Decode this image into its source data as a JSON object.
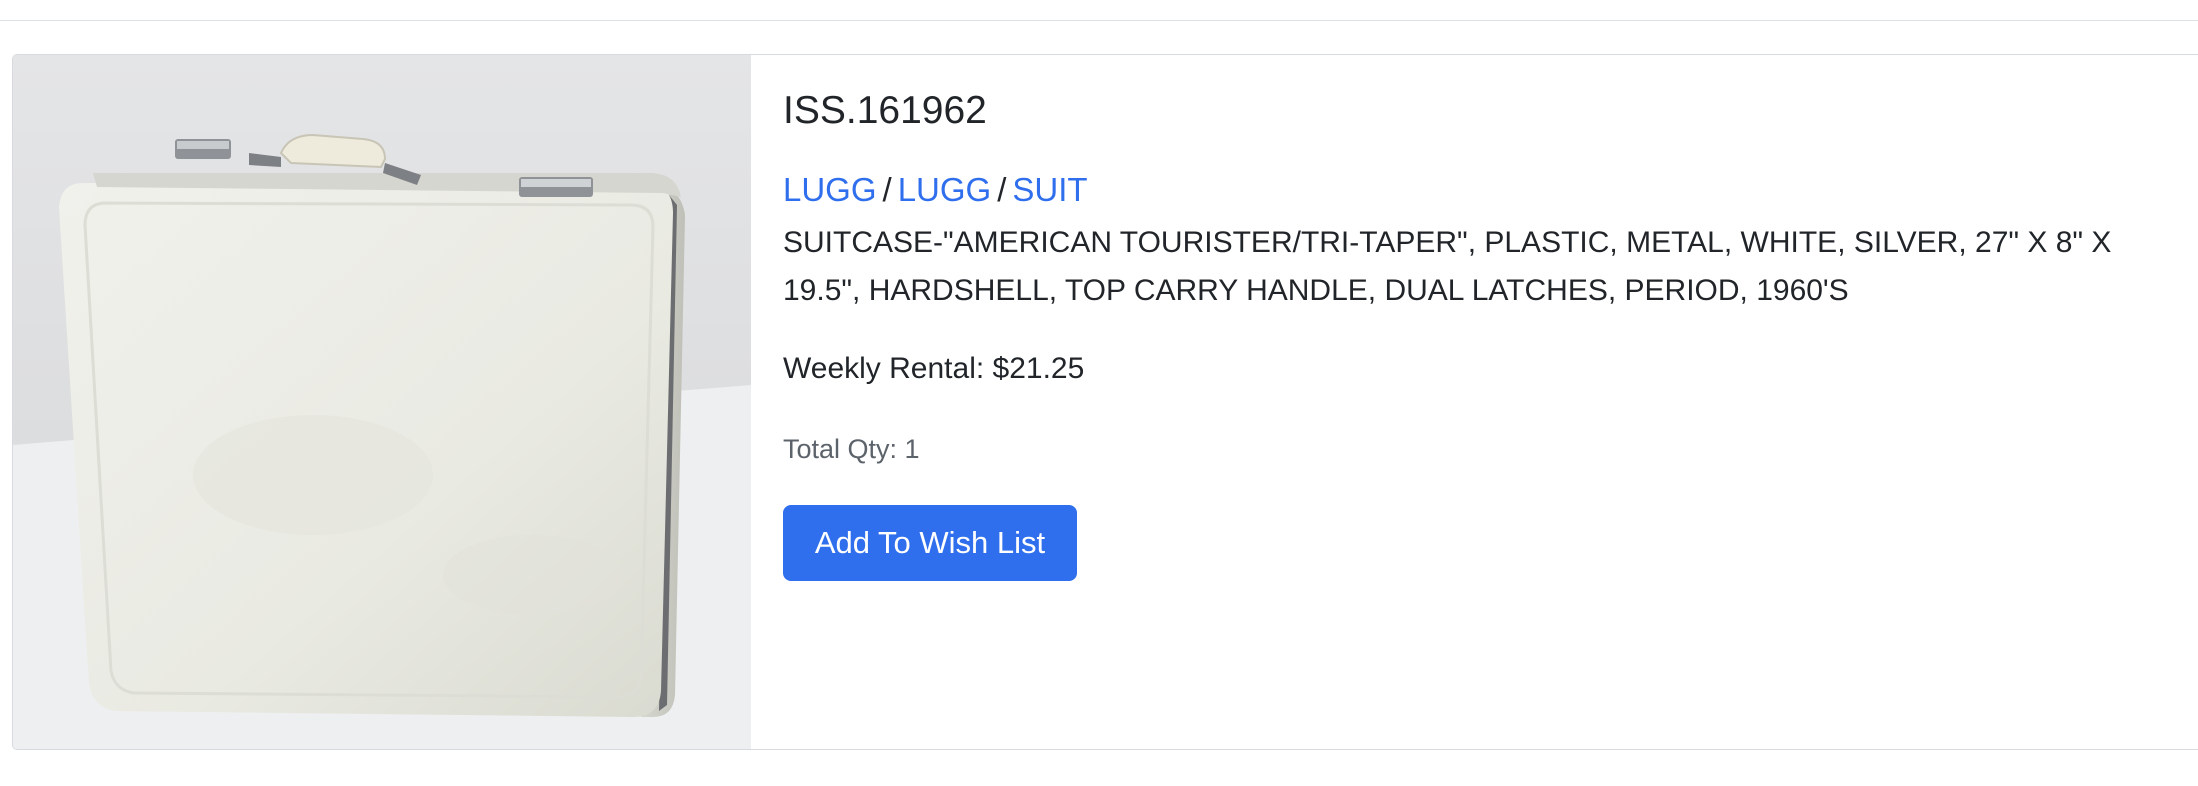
{
  "item": {
    "id": "ISS.161962",
    "breadcrumb": [
      "LUGG",
      "LUGG",
      "SUIT"
    ],
    "breadcrumb_separator": "/",
    "description": "SUITCASE-\"AMERICAN TOURISTER/TRI-TAPER\", PLASTIC, METAL, WHITE, SILVER, 27\" X 8\" X 19.5\", HARDSHELL, TOP CARRY HANDLE, DUAL LATCHES, PERIOD, 1960'S",
    "weekly_rental": "Weekly Rental: $21.25",
    "total_qty": "Total Qty: 1",
    "wish_list_label": "Add To Wish List"
  },
  "colors": {
    "link": "#2f6fed",
    "button": "#2f6fed",
    "text": "#212529",
    "muted": "#5c636a"
  },
  "icons": {
    "photo": "suitcase-photo"
  }
}
